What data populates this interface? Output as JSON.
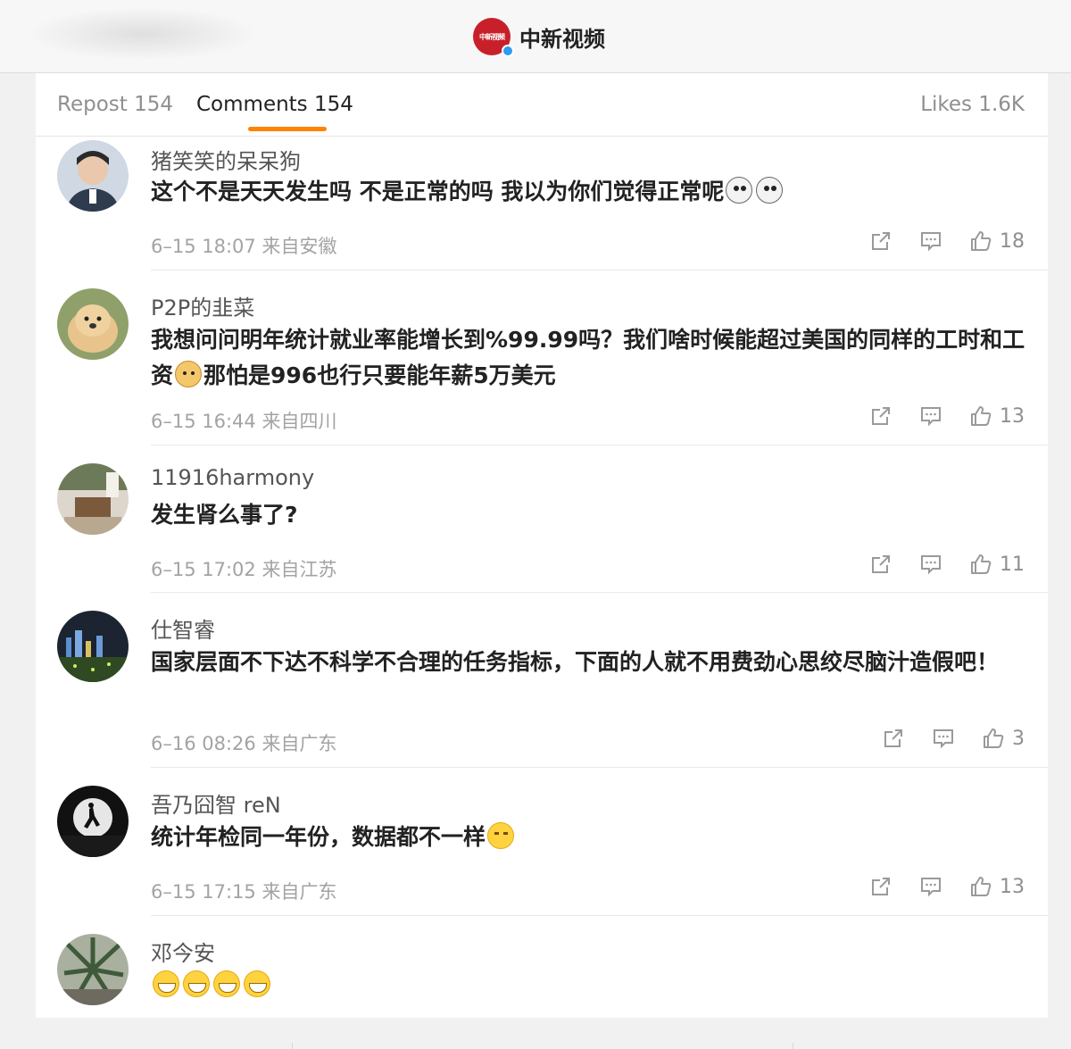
{
  "header": {
    "logo_text": "中新视频",
    "account_name": "中新视频"
  },
  "tabs": {
    "repost": "Repost 154",
    "comments": "Comments 154",
    "likes": "Likes 1.6K"
  },
  "colors": {
    "accent": "#ff8200",
    "brand_red": "#c8202a",
    "verified_blue": "#2d9bf0"
  },
  "comments": [
    {
      "user": "猪笑笑的呆呆狗",
      "text": "这个不是天天发生吗 不是正常的吗 我以为你们觉得正常呢",
      "emoji": [
        "dog-emoji",
        "dog-emoji"
      ],
      "time": "6–15 18:07 来自安徽",
      "likes": "18"
    },
    {
      "user": "P2P的韭菜",
      "text_a": "我想问问明年统计就业率能增长到%99.99吗？我们啥时候能超过美国的同样的工时和工资",
      "text_b": "那怕是996也行只要能年薪5万美元",
      "emoji": [
        "shiba-emoji"
      ],
      "time": "6–15 16:44 来自四川",
      "likes": "13"
    },
    {
      "user": "11916harmony",
      "text": "发生肾么事了?",
      "time": "6–15 17:02 来自江苏",
      "likes": "11"
    },
    {
      "user": "仕智睿",
      "text": "国家层面不下达不科学不合理的任务指标，下面的人就不用费劲心思绞尽脑汁造假吧！",
      "time": "6–16 08:26 来自广东",
      "likes": "3"
    },
    {
      "user": "吾乃囧智 reN",
      "text": "统计年检同一年份，数据都不一样",
      "emoji": [
        "hug-emoji"
      ],
      "time": "6–15 17:15 来自广东",
      "likes": "13"
    },
    {
      "user": "邓今安",
      "emoji": [
        "grin-emoji",
        "grin-emoji",
        "grin-emoji",
        "grin-emoji"
      ]
    }
  ]
}
